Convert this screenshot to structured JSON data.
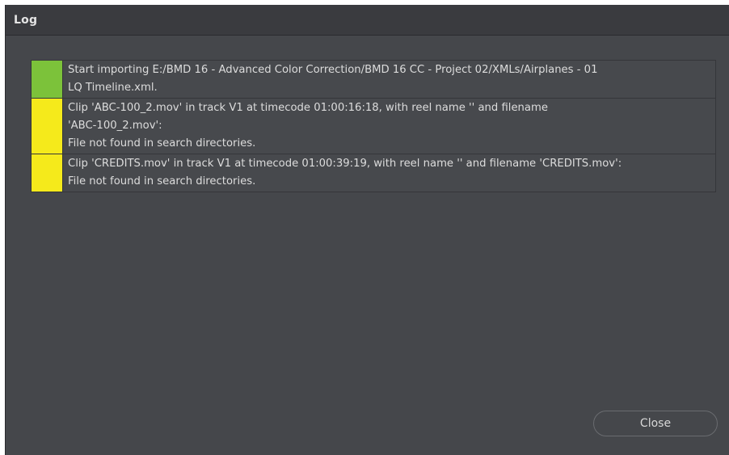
{
  "window": {
    "title": "Log"
  },
  "log": {
    "entries": [
      {
        "severity": "info",
        "color": "#7cc23a",
        "text": "Start importing E:/BMD 16 - Advanced Color Correction/BMD 16 CC - Project 02/XMLs/Airplanes - 01\nLQ Timeline.xml."
      },
      {
        "severity": "warning",
        "color": "#f5ea1b",
        "text": "Clip 'ABC-100_2.mov' in track V1 at timecode 01:00:16:18, with reel name '' and filename\n'ABC-100_2.mov':\nFile not found in search directories."
      },
      {
        "severity": "warning",
        "color": "#f5ea1b",
        "text": "Clip 'CREDITS.mov' in track V1 at timecode 01:00:39:19, with reel name '' and filename 'CREDITS.mov':\nFile not found in search directories."
      }
    ]
  },
  "footer": {
    "close_label": "Close"
  }
}
